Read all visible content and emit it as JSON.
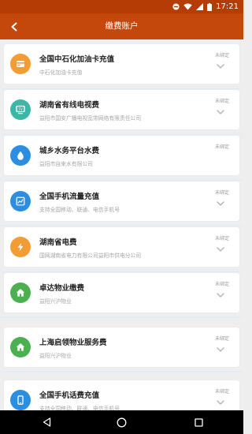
{
  "status_bar": {
    "time": "17:21",
    "icons": [
      "dnd-icon",
      "wifi-icon",
      "signal-icon",
      "battery-icon"
    ]
  },
  "header": {
    "title": "缴费账户",
    "back_icon": "back-arrow-icon"
  },
  "accounts": [
    {
      "title": "全国中石化加油卡充值",
      "subtitle": "中石化加油卡充值",
      "status": "未绑定",
      "icon": "fuel-icon",
      "color": "#f39c34"
    },
    {
      "title": "湖南省有线电视费",
      "subtitle": "益阳市国安广播电视宽带网络有限责任公司",
      "status": "未绑定",
      "icon": "tv-icon",
      "color": "#3cb6a6"
    },
    {
      "title": "城乡水务平台水费",
      "subtitle": "益阳市自来水有限公司",
      "status": "未绑定",
      "icon": "water-drop-icon",
      "color": "#2b8ee0"
    },
    {
      "title": "全国手机流量充值",
      "subtitle": "支持全国移动、联通、电信手机号",
      "status": "未绑定",
      "icon": "traffic-chart-icon",
      "color": "#2b8ee0"
    },
    {
      "title": "湖南省电费",
      "subtitle": "国网湖南省电力有限公司益阳市供电分公司",
      "status": "未绑定",
      "icon": "lightning-icon",
      "color": "#f39c34"
    },
    {
      "title": "卓达物业缴费",
      "subtitle": "益阳兴沪物业",
      "status": "未绑定",
      "icon": "house-icon",
      "color": "#4caf50"
    },
    {
      "title": "上海启领物业服务费",
      "subtitle": "益阳兴沪物业",
      "status": "未绑定",
      "icon": "house-icon",
      "color": "#4caf50"
    },
    {
      "title": "全国手机话费充值",
      "subtitle": "支持全国移动、联通、电信手机号",
      "status": "未绑定",
      "icon": "phone-icon",
      "color": "#2b8ee0"
    }
  ],
  "nav": {
    "icons": [
      "nav-back-icon",
      "nav-home-icon",
      "nav-recents-icon"
    ]
  }
}
